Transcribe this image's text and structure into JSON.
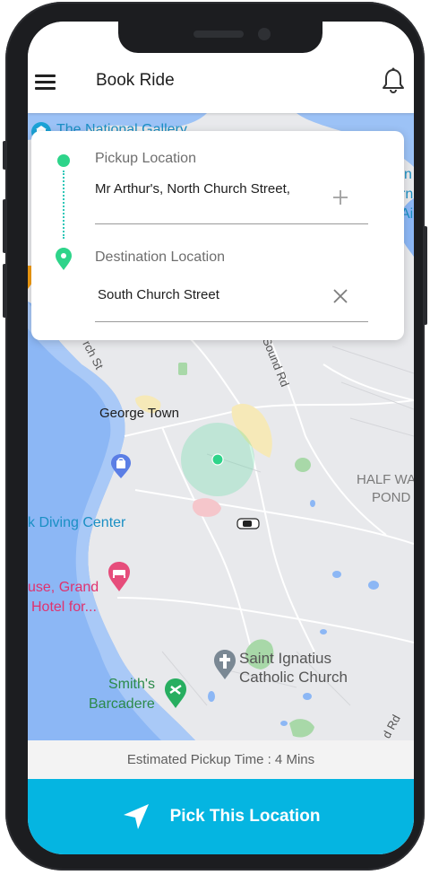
{
  "app_bar": {
    "title": "Book Ride",
    "menu_icon": "hamburger-menu-icon",
    "notification_icon": "bell-icon"
  },
  "booking_card": {
    "pickup_label": "Pickup Location",
    "pickup_value": "Mr Arthur's, North Church Street,",
    "pickup_action_icon": "plus-icon",
    "destination_label": "Destination Location",
    "destination_value": "South Church Street",
    "destination_action_icon": "close-icon"
  },
  "map": {
    "labels": {
      "national_gallery": "The National Gallery",
      "church_st": "rch St",
      "sound_rd": "Sound Rd",
      "george_town": "George Town",
      "diving_center": "k Diving Center",
      "hotel_line1": "use, Grand",
      "hotel_line2": "Hotel for...",
      "half_way_line1": "HALF WA",
      "half_way_line2": "POND",
      "saint_ignatius_line1": "Saint Ignatius",
      "saint_ignatius_line2": "Catholic Church",
      "smiths_line1": "Smith's",
      "smiths_line2": "Barcadere",
      "bottom_rd": "d Rd",
      "right_edge_line1": "n",
      "right_edge_line2": "rn",
      "right_edge_line3": "Air"
    },
    "colors": {
      "water": "#8cb7f5",
      "land": "#e8e9ec",
      "park": "#a8d8a8",
      "pickup_radius": "#2ed48a"
    }
  },
  "eta": {
    "text": "Estimated Pickup Time : 4 Mins"
  },
  "cta": {
    "label": "Pick This Location",
    "icon": "navigation-arrow-icon"
  }
}
